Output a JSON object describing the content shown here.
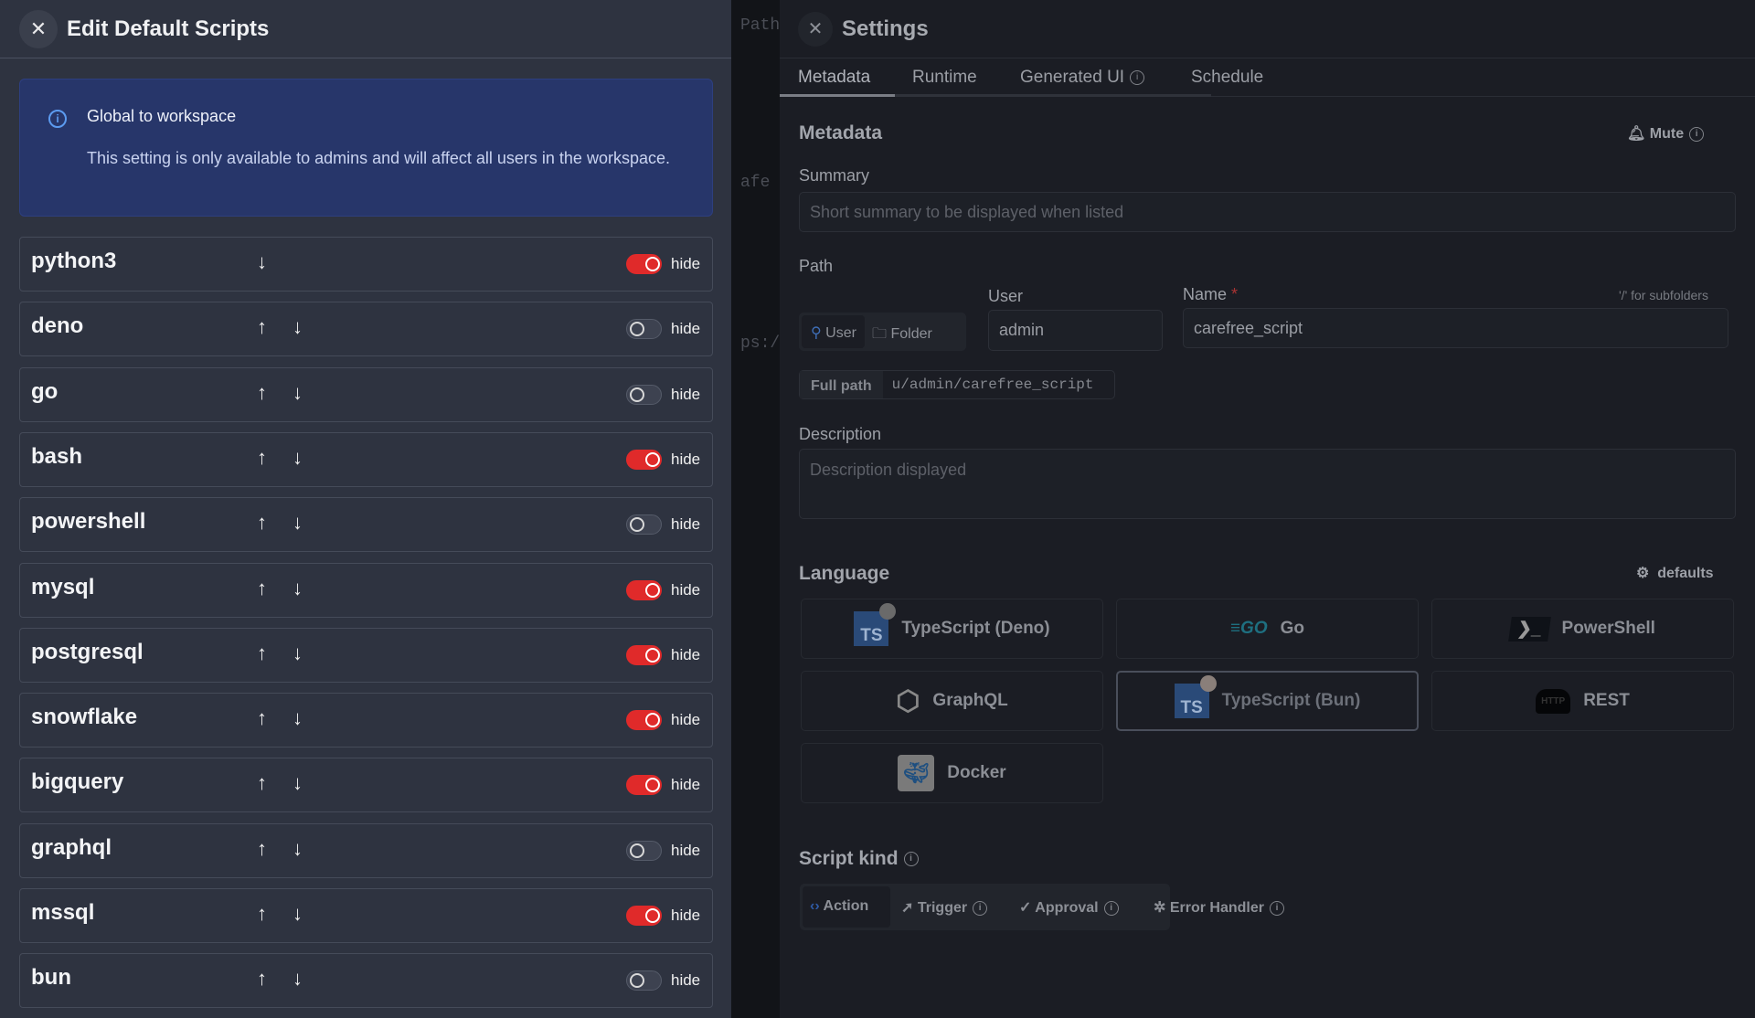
{
  "background": {
    "fragments": [
      "Path",
      "afe r",
      "ps://"
    ]
  },
  "left": {
    "title": "Edit Default Scripts",
    "info": {
      "title": "Global to workspace",
      "text": "This setting is only available to admins and will affect all users in the workspace."
    },
    "hide_label": "hide",
    "scripts": [
      {
        "name": "python3",
        "hidden": true
      },
      {
        "name": "deno",
        "hidden": false
      },
      {
        "name": "go",
        "hidden": false
      },
      {
        "name": "bash",
        "hidden": true
      },
      {
        "name": "powershell",
        "hidden": false
      },
      {
        "name": "mysql",
        "hidden": true
      },
      {
        "name": "postgresql",
        "hidden": true
      },
      {
        "name": "snowflake",
        "hidden": true
      },
      {
        "name": "bigquery",
        "hidden": true
      },
      {
        "name": "graphql",
        "hidden": false
      },
      {
        "name": "mssql",
        "hidden": true
      },
      {
        "name": "bun",
        "hidden": false
      }
    ],
    "accent": "#e02a2a"
  },
  "right": {
    "title": "Settings",
    "tabs": [
      "Metadata",
      "Runtime",
      "Generated UI",
      "Schedule"
    ],
    "active_tab": "Metadata",
    "metadata_title": "Metadata",
    "mute": "Mute",
    "summary_label": "Summary",
    "summary_placeholder": "Short summary to be displayed when listed",
    "path_label": "Path",
    "owner_options": [
      "User",
      "Folder"
    ],
    "user_label": "User",
    "user_value": "admin",
    "name_label": "Name",
    "name_required": "*",
    "name_hint": "'/' for subfolders",
    "name_value": "carefree_script",
    "full_path_label": "Full path",
    "full_path_value": "u/admin/carefree_script",
    "description_label": "Description",
    "description_placeholder": "Description displayed",
    "language_title": "Language",
    "defaults": "defaults",
    "languages": [
      "TypeScript (Deno)",
      "Go",
      "PowerShell",
      "GraphQL",
      "TypeScript (Bun)",
      "REST",
      "Docker"
    ],
    "selected_language": "TypeScript (Bun)",
    "script_kind_title": "Script kind",
    "script_kinds": [
      "Action",
      "Trigger",
      "Approval",
      "Error Handler"
    ],
    "selected_kind": "Action"
  }
}
